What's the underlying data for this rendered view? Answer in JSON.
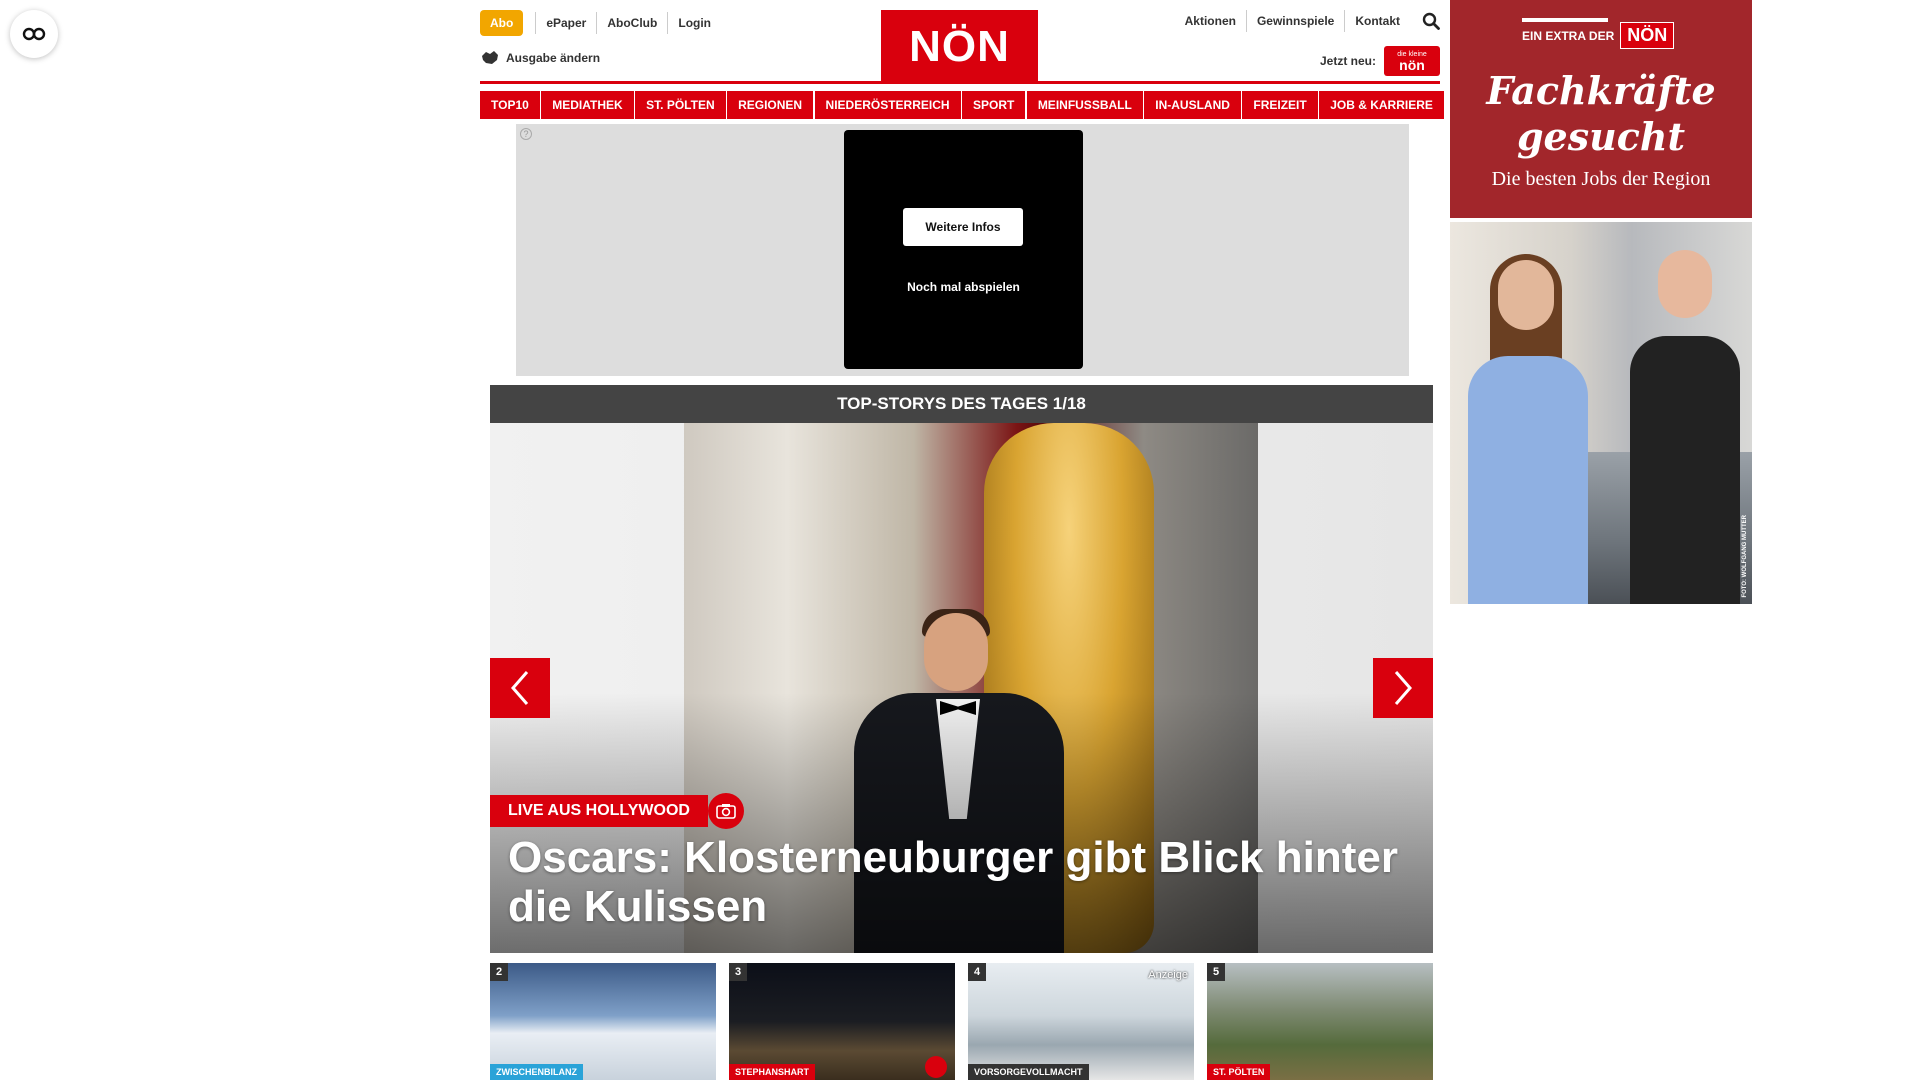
{
  "header": {
    "abo_label": "Abo",
    "links": [
      "ePaper",
      "AboClub",
      "Login"
    ],
    "edition_label": "Ausgabe ändern",
    "logo_text": "NÖN",
    "right_links": [
      "Aktionen",
      "Gewinnspiele",
      "Kontakt"
    ],
    "jetzt_neu_label": "Jetzt neu:",
    "mini_logo_small": "die kleine",
    "mini_logo_text": "nön"
  },
  "nav": {
    "items": [
      "TOP10",
      "MEDIATHEK",
      "ST. PÖLTEN",
      "REGIONEN",
      "NIEDERÖSTERREICH",
      "SPORT",
      "MEINFUSSBALL",
      "IN-AUSLAND",
      "FREIZEIT",
      "JOB & KARRIERE"
    ]
  },
  "ad_banner": {
    "info_button": "Weitere Infos",
    "replay_label": "Noch mal abspielen"
  },
  "top_stories": {
    "header": "TOP-STORYS DES TAGES 1/18",
    "hero": {
      "tag": "LIVE AUS HOLLYWOOD",
      "title": "Oscars: Klosterneuburger gibt Blick hinter die Kulissen"
    },
    "thumbs": [
      {
        "num": "2",
        "tag": "ZWISCHENBILANZ",
        "tag_color": "#2aa3d8"
      },
      {
        "num": "3",
        "tag": "STEPHANSHART",
        "tag_color": "#d9000d"
      },
      {
        "num": "4",
        "tag": "VORSORGEVOLLMACHT",
        "tag_color": "#333333",
        "anzeige": "Anzeige"
      },
      {
        "num": "5",
        "tag": "ST. PÖLTEN",
        "tag_color": "#d9000d"
      }
    ]
  },
  "side_ad": {
    "extra_label": "EIN EXTRA DER",
    "badge": "NÖN",
    "headline_1": "Fachkräfte",
    "headline_2": "gesucht",
    "subline": "Die besten Jobs der Region",
    "credit": "FOTO: WOLFGANG MÜTTER"
  },
  "colors": {
    "brand_red": "#d9000d",
    "abo_orange": "#f2a600",
    "dark_header": "#444444",
    "side_ad_bg": "#a2262b"
  }
}
